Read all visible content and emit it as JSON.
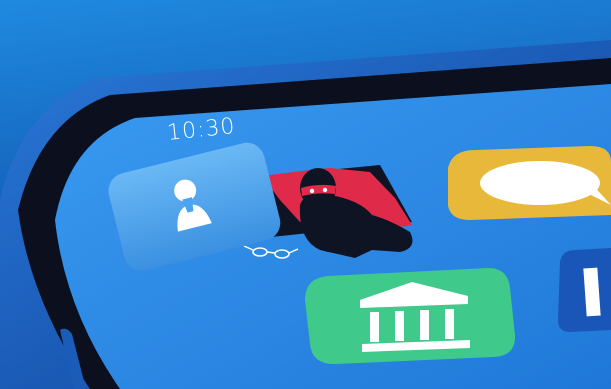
{
  "scene": {
    "type": "illustration",
    "subject": "phone-home-screen-hacker"
  },
  "phone": {
    "status_time": "10:30"
  },
  "icons": [
    {
      "name": "contacts-app-icon",
      "kind": "person-silhouette"
    },
    {
      "name": "messages-app-icon",
      "kind": "speech-bubble"
    },
    {
      "name": "bank-app-icon",
      "kind": "bank-building"
    },
    {
      "name": "partial-app-icon",
      "kind": "unknown-cropped"
    }
  ],
  "colors": {
    "background_top": "#1a7fd6",
    "background_bottom": "#0a1f4a",
    "phone_frame": "#0b0f1e",
    "screen": "#2f8fe6",
    "contacts_icon": "#4aa5f0",
    "messages_icon": "#e8b83a",
    "bank_icon": "#3fc98a",
    "hacker_cloak": "#e02a4a",
    "hacker_body": "#0e1424"
  }
}
